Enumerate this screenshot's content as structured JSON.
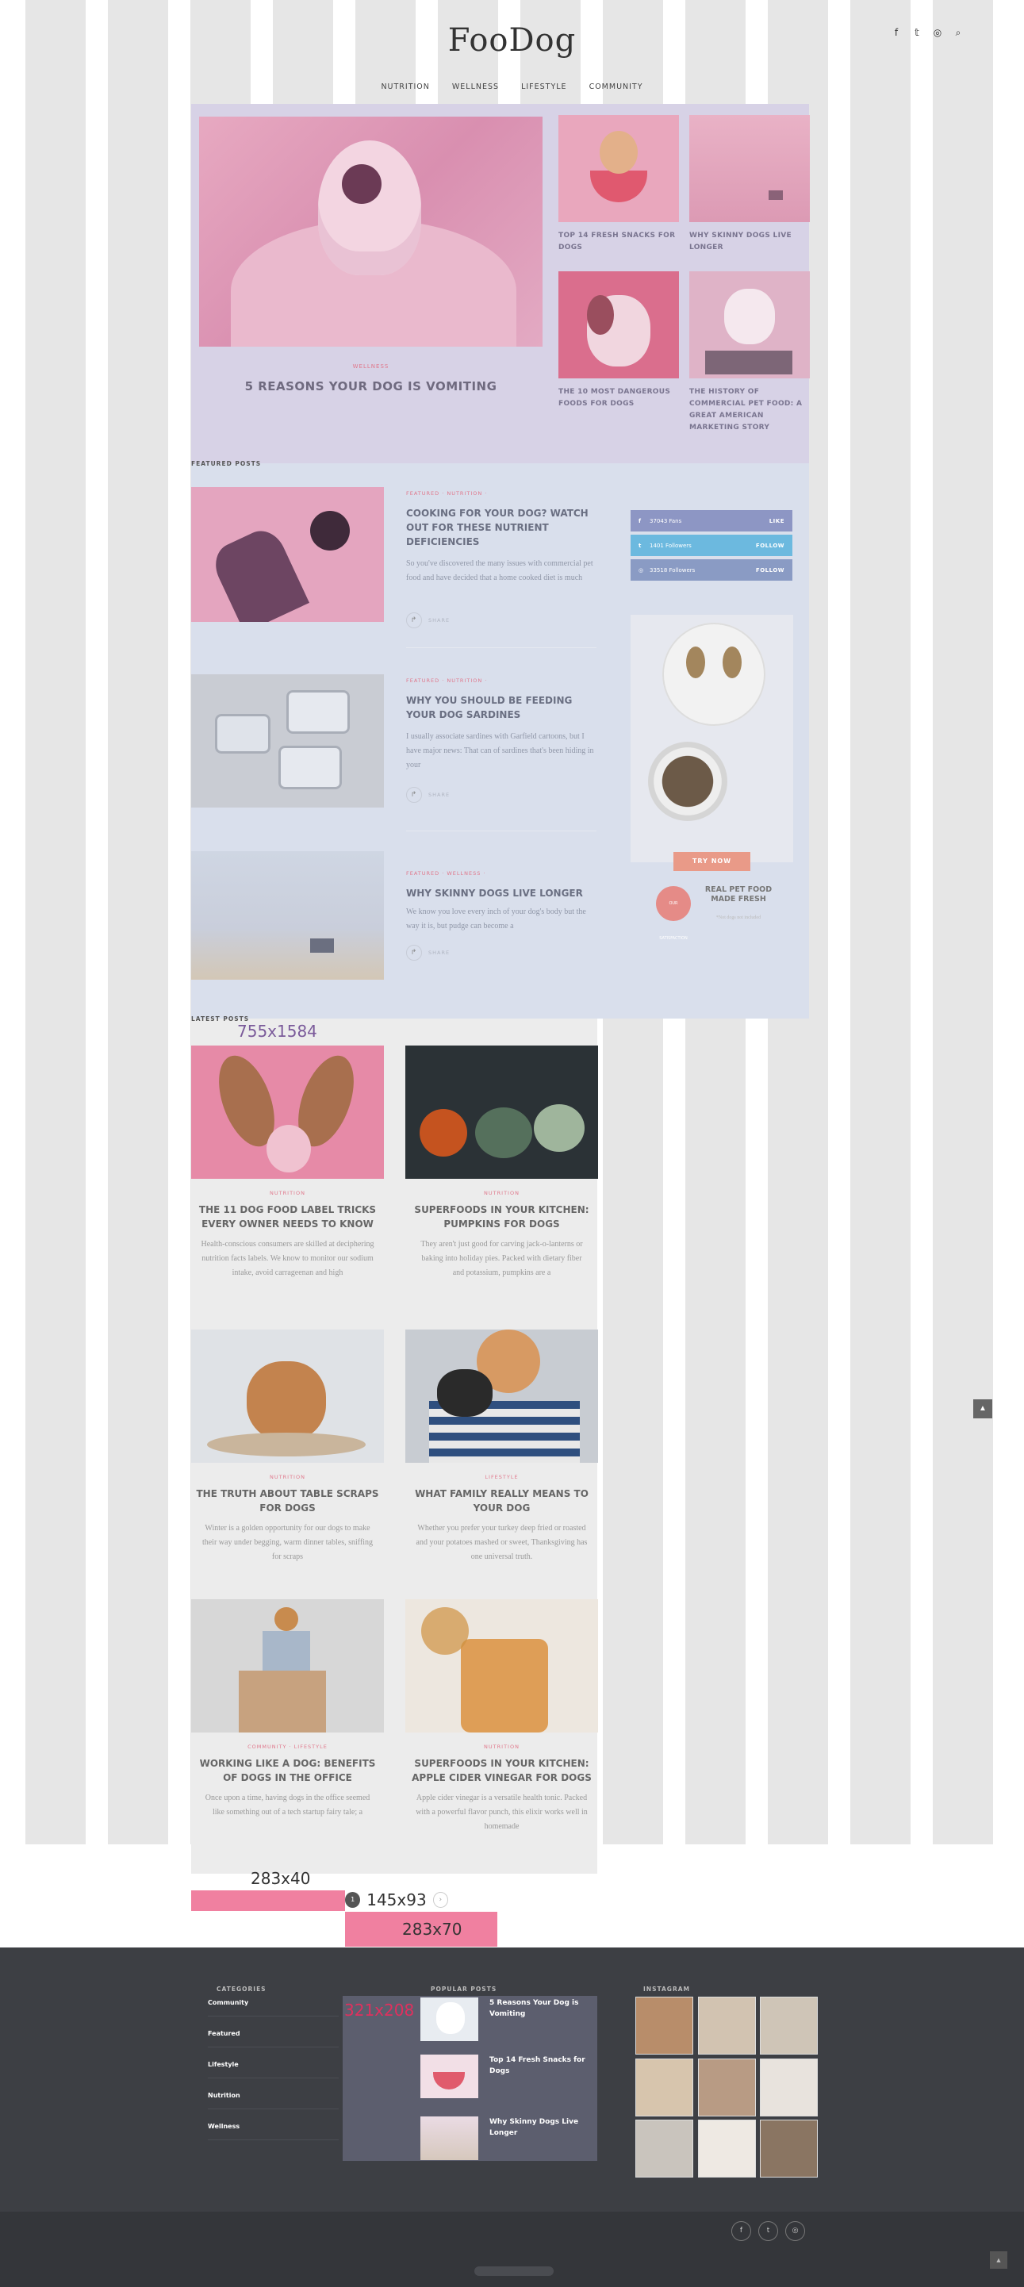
{
  "site": {
    "logo": "FooDog"
  },
  "header": {
    "icons": [
      "facebook-icon",
      "twitter-icon",
      "instagram-icon",
      "search-icon"
    ],
    "icon_glyphs": [
      "f",
      "𝕥",
      "◎",
      "⌕"
    ]
  },
  "nav": {
    "items": [
      "NUTRITION",
      "WELLNESS",
      "LIFESTYLE",
      "COMMUNITY"
    ]
  },
  "hero": {
    "category": "WELLNESS",
    "title": "5 REASONS YOUR DOG IS VOMITING",
    "cards": [
      {
        "title": "TOP 14 FRESH SNACKS FOR DOGS"
      },
      {
        "title": "WHY SKINNY DOGS LIVE LONGER"
      },
      {
        "title": "THE 10 MOST DANGEROUS FOODS FOR DOGS"
      },
      {
        "title": "THE HISTORY OF COMMERCIAL PET FOOD: A GREAT AMERICAN MARKETING STORY"
      }
    ]
  },
  "featured": {
    "label": "FEATURED POSTS",
    "posts": [
      {
        "meta": "FEATURED · NUTRITION ·",
        "title": "COOKING FOR YOUR DOG? WATCH OUT FOR THESE NUTRIENT DEFICIENCIES",
        "excerpt": "So you've discovered the many issues with commercial pet food and have decided that a home cooked diet is much",
        "share": "SHARE"
      },
      {
        "meta": "FEATURED · NUTRITION ·",
        "title": "WHY YOU SHOULD BE FEEDING YOUR DOG SARDINES",
        "excerpt": "I usually associate sardines with Garfield cartoons, but I have major news: That can of sardines that's been hiding in your",
        "share": "SHARE"
      },
      {
        "meta": "FEATURED · WELLNESS ·",
        "title": "WHY SKINNY DOGS LIVE LONGER",
        "excerpt": "We know you love every inch of your dog's body but the way it is, but pudge can become a",
        "share": "SHARE"
      }
    ]
  },
  "sidebar": {
    "social": [
      {
        "icon": "f",
        "label": "37043 Fans",
        "action": "LIKE",
        "color": "#8d96c4"
      },
      {
        "icon": "t",
        "label": "1401 Followers",
        "action": "FOLLOW",
        "color": "#6cb9df"
      },
      {
        "icon": "◎",
        "label": "33518 Followers",
        "action": "FOLLOW",
        "color": "#8a9bc4"
      }
    ],
    "ad": {
      "button": "TRY NOW",
      "badge": "OUR SATISFACTION",
      "headline": "REAL PET FOOD MADE FRESH",
      "small": "*Not dogs not included"
    }
  },
  "latest": {
    "label": "LATEST POSTS",
    "size_tag": "755x1584",
    "posts": [
      {
        "cat": "NUTRITION",
        "title": "THE 11 DOG FOOD LABEL TRICKS EVERY OWNER NEEDS TO KNOW",
        "excerpt": "Health-conscious consumers are skilled at deciphering nutrition facts labels. We know to monitor our sodium intake, avoid carrageenan and high"
      },
      {
        "cat": "NUTRITION",
        "title": "SUPERFOODS IN YOUR KITCHEN: PUMPKINS FOR DOGS",
        "excerpt": "They aren't just good for carving jack-o-lanterns or baking into holiday pies. Packed with dietary fiber and potassium, pumpkins are a"
      },
      {
        "cat": "NUTRITION",
        "title": "THE TRUTH ABOUT TABLE SCRAPS FOR DOGS",
        "excerpt": "Winter is a golden opportunity for our dogs to make their way under begging, warm dinner tables, sniffing for scraps"
      },
      {
        "cat": "LIFESTYLE",
        "title": "WHAT FAMILY REALLY MEANS TO YOUR DOG",
        "excerpt": "Whether you prefer your turkey deep fried or roasted and your potatoes mashed or sweet, Thanksgiving has one universal truth."
      },
      {
        "cat": "COMMUNITY · LIFESTYLE",
        "title": "WORKING LIKE A DOG: BENEFITS OF DOGS IN THE OFFICE",
        "excerpt": "Once upon a time, having dogs in the office seemed like something out of a tech startup fairy tale; a"
      },
      {
        "cat": "NUTRITION",
        "title": "SUPERFOODS IN YOUR KITCHEN: APPLE CIDER VINEGAR FOR DOGS",
        "excerpt": "Apple cider vinegar is a versatile health tonic. Packed with a powerful flavor punch, this elixir works well in homemade"
      }
    ]
  },
  "overlays": {
    "tag1": "283x40",
    "tag2": "145x93",
    "tag3": "283x70",
    "tag4": "321x208"
  },
  "pagination": {
    "current": "1",
    "next": "›"
  },
  "back_to_top": "▲",
  "footer": {
    "categories_title": "CATEGORIES",
    "categories": [
      "Community",
      "Featured",
      "Lifestyle",
      "Nutrition",
      "Wellness"
    ],
    "popular_title": "POPULAR POSTS",
    "popular": [
      "5 Reasons Your Dog is Vomiting",
      "Top 14 Fresh Snacks for Dogs",
      "Why Skinny Dogs Live Longer"
    ],
    "instagram_title": "INSTAGRAM",
    "social": [
      "f",
      "t",
      "◎"
    ],
    "top": "▲"
  }
}
